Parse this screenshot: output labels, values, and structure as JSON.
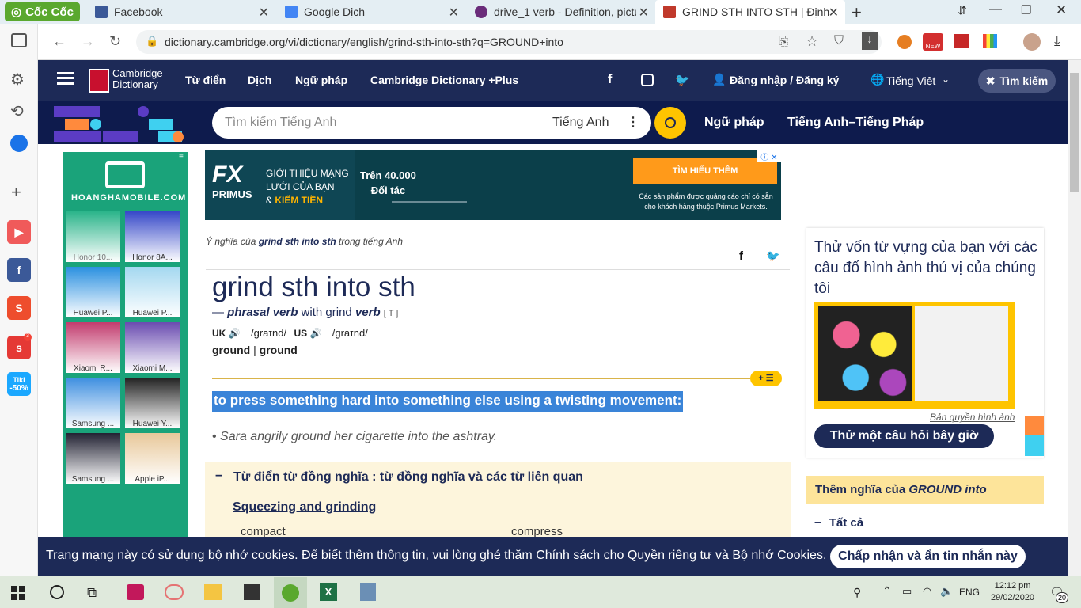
{
  "browser": {
    "brand": "Cốc Cốc",
    "tabs": [
      {
        "title": "Facebook",
        "color": "#3b5998"
      },
      {
        "title": "Google Dịch",
        "color": "#4285f4"
      },
      {
        "title": "drive_1 verb - Definition, pictu",
        "color": "#6a2c7a"
      },
      {
        "title": "GRIND STH INTO STH | Định n",
        "color": "#c0392b"
      }
    ],
    "url": "dictionary.cambridge.org/vi/dictionary/english/grind-sth-into-sth?q=GROUND+into"
  },
  "site": {
    "logo_line1": "Cambridge",
    "logo_line2": "Dictionary",
    "nav": [
      "Từ điển",
      "Dịch",
      "Ngữ pháp",
      "Cambridge Dictionary +Plus"
    ],
    "login": "Đăng nhập / Đăng ký",
    "language": "Tiếng Việt",
    "search_btn": "Tìm kiếm",
    "search_placeholder": "Tìm kiếm Tiếng Anh",
    "search_lang": "Tiếng Anh",
    "sub_links": [
      "Ngữ pháp",
      "Tiếng Anh–Tiếng Pháp"
    ]
  },
  "ad_left": {
    "brand": "HOANGHAMOBILE.COM",
    "phones": [
      "Honor 10...",
      "Honor 8A...",
      "Huawei P...",
      "Huawei P...",
      "Xiaomi R...",
      "Xiaomi M...",
      "Samsung ...",
      "Huawei Y...",
      "Samsung ...",
      "Apple iP..."
    ]
  },
  "banner": {
    "logo": "FX",
    "logo_sub": "PRIMUS",
    "line1": "GIỚI THIỆU MẠNG",
    "line2": "LƯỚI CỦA BẠN",
    "line3_prefix": "& ",
    "line3": "KIẾM TIỀN",
    "partners": "Trên 40.000",
    "partners2": "Đối tác",
    "cta": "TÌM HIỂU THÊM",
    "note": "Các sản phẩm được quảng cáo chỉ có sẵn cho khách hàng thuộc Primus Markets."
  },
  "entry": {
    "breadcrumb_prefix": "Ý nghĩa của ",
    "breadcrumb_term": "grind sth into sth",
    "breadcrumb_suffix": " trong tiếng Anh",
    "headword": "grind sth into sth",
    "pos_dash": "— ",
    "pos": "phrasal verb",
    "pos_with": " with grind ",
    "pos_verb": "verb",
    "grammar": "[ T ]",
    "uk": "UK",
    "uk_ipa": "/ɡraɪnd/",
    "us": "US",
    "us_ipa": "/ɡraɪnd/",
    "forms": "ground",
    "forms_sep": "|",
    "forms2": "ground",
    "definition": "to press something hard into something else using a twisting movement:",
    "example": "Sara angrily ground her cigarette into the ashtray.",
    "thesaurus_title": "Từ điển từ đồng nghĩa : từ đồng nghĩa và các từ liên quan",
    "thesaurus_group": "Squeezing and grinding",
    "thesaurus_words": [
      "compact",
      "compress"
    ]
  },
  "right": {
    "quiz_title": "Thử vốn từ vựng của bạn với các câu đố hình ảnh thú vị của chúng tôi",
    "copyright": "Bản quyền hình ảnh",
    "quiz_btn": "Thử một câu hỏi bây giờ",
    "more_prefix": "Thêm nghĩa của ",
    "more_term": "GROUND into",
    "all": "Tất cả"
  },
  "cookie": {
    "text": "Trang mạng này có sử dụng bộ nhớ cookies. Để biết thêm thông tin, vui lòng ghé thăm ",
    "link": "Chính sách cho Quyền riêng tư và Bộ nhớ Cookies",
    "end": ".",
    "btn": "Chấp nhận và ẩn tin nhắn này"
  },
  "taskbar": {
    "lang": "ENG",
    "time": "12:12 pm",
    "date": "29/02/2020",
    "notif": "20"
  },
  "sidebar_badges": {
    "tiki": "Tiki",
    "tiki_sale": "-50%",
    "shopee": "S",
    "notif": "3"
  }
}
